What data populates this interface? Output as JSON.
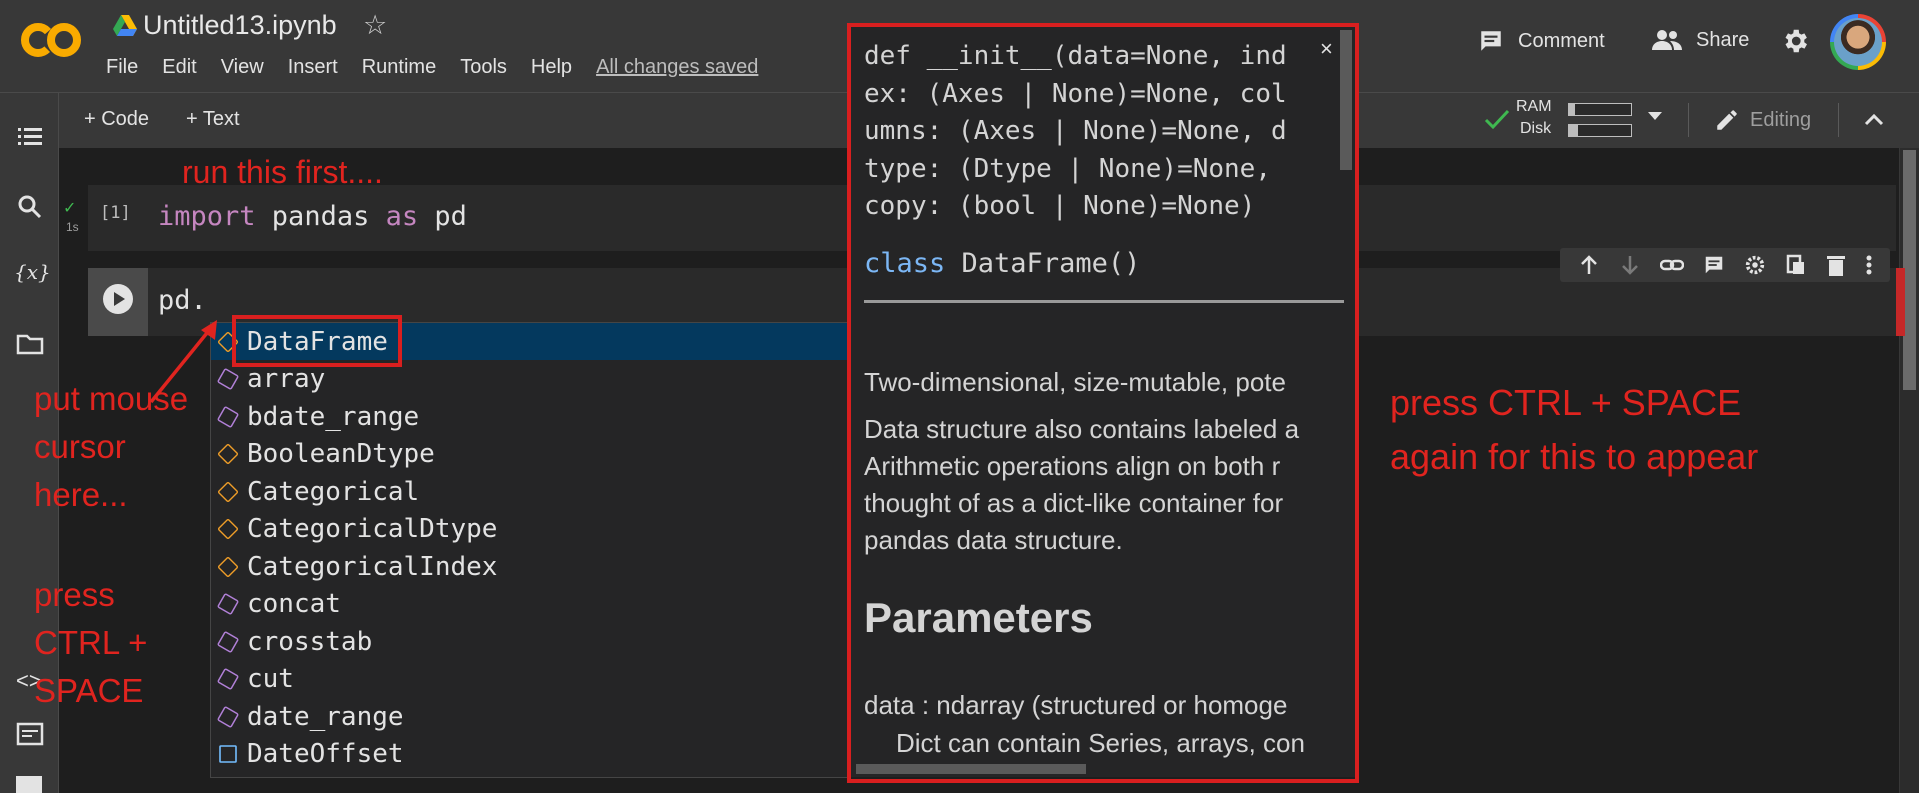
{
  "app": {
    "logo_text": "CO",
    "file_title": "Untitled13.ipynb",
    "menu": [
      "File",
      "Edit",
      "View",
      "Insert",
      "Runtime",
      "Tools",
      "Help"
    ],
    "save_status": "All changes saved",
    "comment_label": "Comment",
    "share_label": "Share"
  },
  "toolbar": {
    "add_code": "+ Code",
    "add_text": "+ Text",
    "ram_label": "RAM",
    "disk_label": "Disk",
    "ram_usage": 0.1,
    "disk_usage": 0.15,
    "editing_label": "Editing"
  },
  "cells": {
    "cell1": {
      "exec_count": "[1]",
      "time": "1s",
      "code_kw1": "import",
      "code_mod": " pandas ",
      "code_kw2": "as",
      "code_alias": " pd"
    },
    "cell2": {
      "code": "pd."
    }
  },
  "autocomplete": {
    "items": [
      {
        "label": "DataFrame",
        "kind": "class"
      },
      {
        "label": "array",
        "kind": "function"
      },
      {
        "label": "bdate_range",
        "kind": "function"
      },
      {
        "label": "BooleanDtype",
        "kind": "class"
      },
      {
        "label": "Categorical",
        "kind": "class"
      },
      {
        "label": "CategoricalDtype",
        "kind": "class"
      },
      {
        "label": "CategoricalIndex",
        "kind": "class"
      },
      {
        "label": "concat",
        "kind": "function"
      },
      {
        "label": "crosstab",
        "kind": "function"
      },
      {
        "label": "cut",
        "kind": "function"
      },
      {
        "label": "date_range",
        "kind": "function"
      },
      {
        "label": "DateOffset",
        "kind": "object"
      }
    ]
  },
  "doc": {
    "signature": "def __init__(data=None, ind\nex: (Axes | None)=None, col\numns: (Axes | None)=None, d\ntype: (Dtype | None)=None,\ncopy: (bool | None)=None)",
    "class_kw": "class",
    "class_name": " DataFrame()",
    "close": "×",
    "body_lines": [
      "Two-dimensional, size-mutable, pote",
      "",
      "Data structure also contains labeled a",
      "Arithmetic operations align on both r",
      "thought of as a dict-like container for",
      "pandas data structure."
    ],
    "params_heading": "Parameters",
    "data_line": "data : ndarray (structured or homoge",
    "data_line2": "Dict can contain Series, arrays, con"
  },
  "annotations": {
    "run_first": "run this first....",
    "put_mouse": "put mouse\ncursor\nhere...",
    "press_ctrl": "press\nCTRL +\nSPACE",
    "press_again": "press CTRL + SPACE\nagain for this to appear"
  },
  "colors": {
    "annotation_red": "#e0241f",
    "selected_item": "#04395e",
    "keyword": "#c586c0"
  }
}
